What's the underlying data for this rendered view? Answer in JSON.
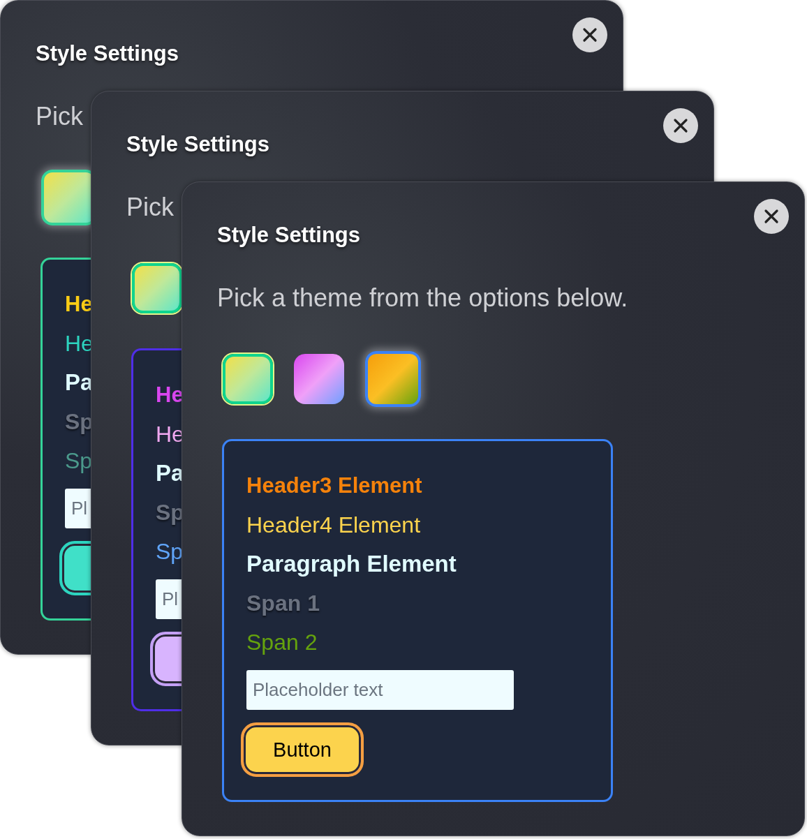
{
  "windows": [
    {
      "title": "Style Settings",
      "description": "Pick",
      "swatches": [
        {
          "kind": "lime",
          "selected": true
        }
      ],
      "preview": {
        "color": "#34d399",
        "items": [
          {
            "kind": "header3",
            "text": "He",
            "color": "#facc15"
          },
          {
            "kind": "header4",
            "text": "He",
            "color": "#2dd4bf"
          },
          {
            "kind": "paragraph",
            "text": "Pa",
            "color": "#e0fbff"
          },
          {
            "kind": "span1",
            "text": "Sp",
            "color": "#6b7280"
          },
          {
            "kind": "span2",
            "text": "Sp",
            "color": "#4b9a8c"
          }
        ],
        "input": {
          "placeholder": "Pl"
        },
        "button": {
          "color": "#40e0c8",
          "outline": {
            "color": "#2dd4bf"
          }
        }
      }
    },
    {
      "title": "Style Settings",
      "description": "Pick",
      "swatches": [
        {
          "kind": "lime",
          "selected": false
        }
      ],
      "preview": {
        "color": "#4f2ee8",
        "items": [
          {
            "kind": "header3",
            "text": "He",
            "color": "#d946ef"
          },
          {
            "kind": "header4",
            "text": "He",
            "color": "#f0a8f0"
          },
          {
            "kind": "paragraph",
            "text": "Pa",
            "color": "#e0fbff"
          },
          {
            "kind": "span1",
            "text": "Sp",
            "color": "#6b7280"
          },
          {
            "kind": "span2",
            "text": "Sp",
            "color": "#60a5fa"
          }
        ],
        "input": {
          "placeholder": "Pl"
        },
        "button": {
          "color": "#d8b4fe",
          "outline": {
            "color": "#c4a0f5"
          }
        }
      }
    },
    {
      "title": "Style Settings",
      "description": "Pick a theme from the options below.",
      "swatches": [
        {
          "kind": "lime",
          "selected": false
        },
        {
          "kind": "pink",
          "selected": false
        },
        {
          "kind": "amber",
          "selected": true
        }
      ],
      "preview": {
        "color": "#3b82f6",
        "items": [
          {
            "kind": "header3",
            "text": "Header3 Element",
            "color": "#f5820b"
          },
          {
            "kind": "header4",
            "text": "Header4 Element",
            "color": "#fcd34d"
          },
          {
            "kind": "paragraph",
            "text": "Paragraph Element",
            "color": "#e0fbff"
          },
          {
            "kind": "span1",
            "text": "Span 1",
            "color": "#6b7280"
          },
          {
            "kind": "span2",
            "text": "Span 2",
            "color": "#65a30d"
          }
        ],
        "input": {
          "placeholder": "Placeholder text"
        },
        "button": {
          "label": "Button",
          "color": "#fcd34d",
          "outline": {
            "color": "#f59e42"
          }
        }
      }
    }
  ]
}
